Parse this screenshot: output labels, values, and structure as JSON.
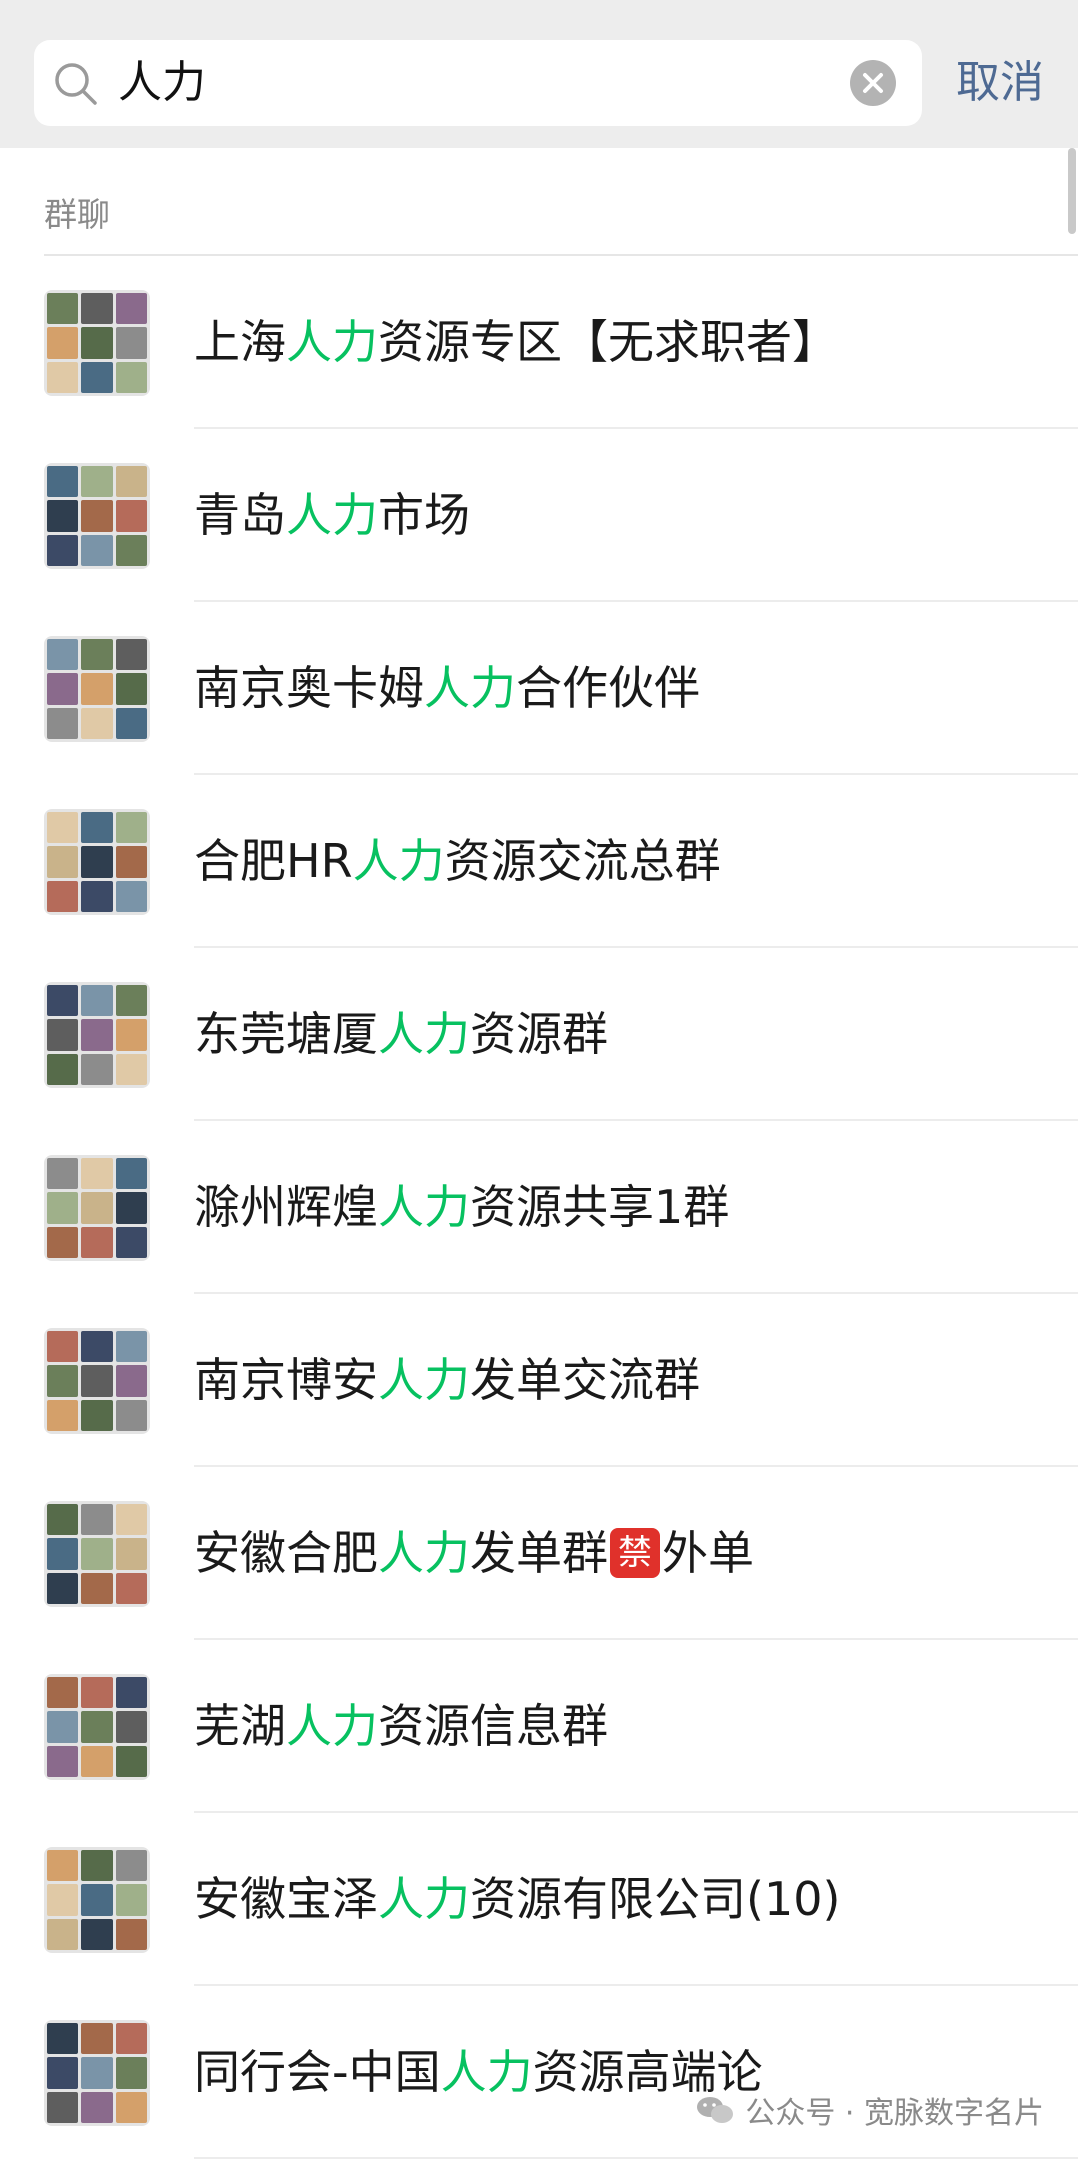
{
  "search": {
    "query": "人力",
    "cancel_label": "取消"
  },
  "section": {
    "label": "群聊"
  },
  "colors": {
    "highlight": "#07c160",
    "cancel": "#4e6a93",
    "topbar": "#ededed"
  },
  "groups": [
    {
      "before": "上海",
      "match": "人力",
      "after": "资源专区【无求职者】"
    },
    {
      "before": "青岛",
      "match": "人力",
      "after": "市场"
    },
    {
      "before": "南京奥卡姆",
      "match": "人力",
      "after": "合作伙伴"
    },
    {
      "before": "合肥HR",
      "match": "人力",
      "after": "资源交流总群"
    },
    {
      "before": "东莞塘厦",
      "match": "人力",
      "after": "资源群"
    },
    {
      "before": "滁州辉煌",
      "match": "人力",
      "after": "资源共享1群"
    },
    {
      "before": "南京博安",
      "match": "人力",
      "after": "发单交流群"
    },
    {
      "before": "安徽合肥",
      "match": "人力",
      "after": "发单群",
      "badge": "禁",
      "after2": "外单"
    },
    {
      "before": "芜湖",
      "match": "人力",
      "after": "资源信息群"
    },
    {
      "before": "安徽宝泽",
      "match": "人力",
      "after": "资源有限公司(10)"
    },
    {
      "before": "同行会-中国",
      "match": "人力",
      "after": "资源高端论"
    }
  ],
  "watermark": {
    "text": "公众号 · 宽脉数字名片",
    "icon": "wechat-icon"
  }
}
